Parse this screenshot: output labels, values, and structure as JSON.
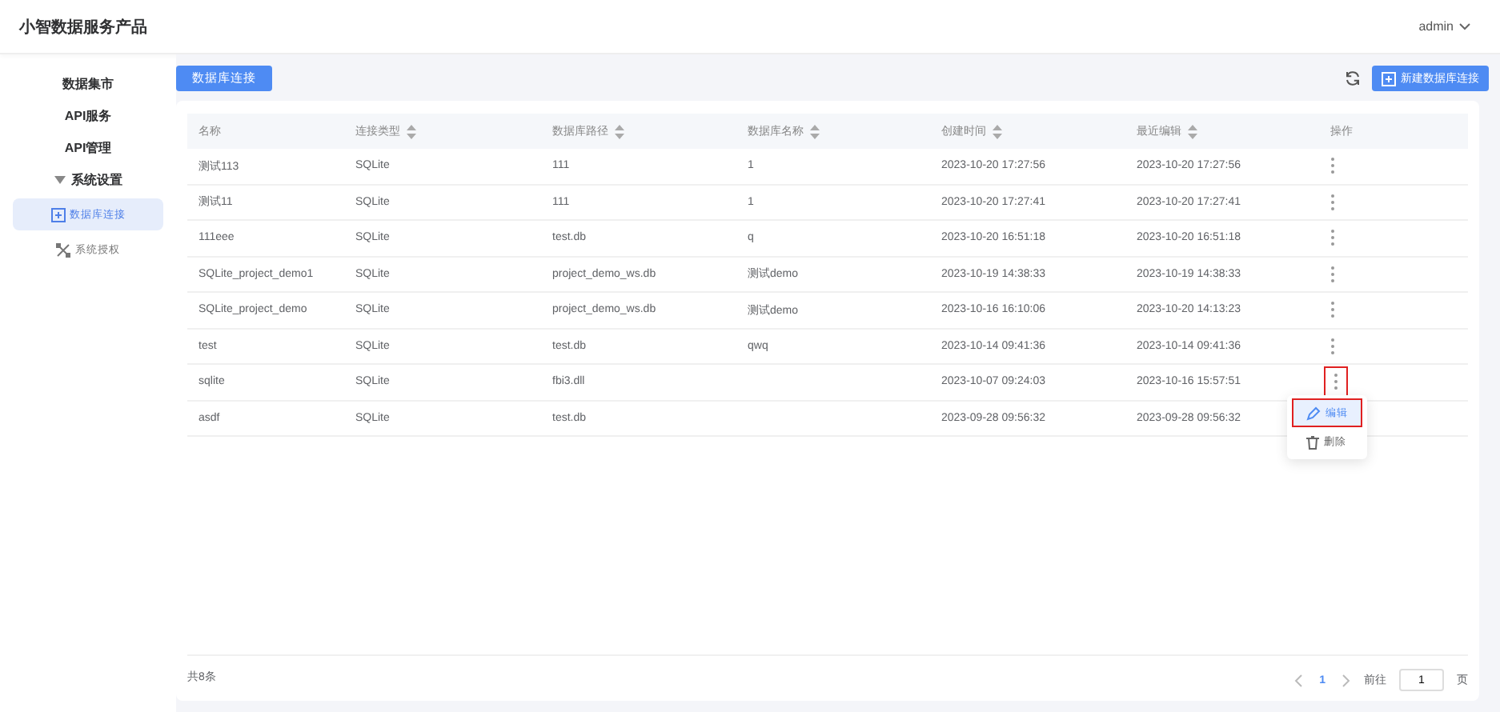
{
  "header": {
    "title": "小智数据服务产品",
    "user": "admin"
  },
  "sidebar": {
    "items": [
      {
        "label": "数据集市",
        "selected": false
      },
      {
        "label": "API服务",
        "selected": false
      },
      {
        "label": "API管理",
        "selected": false
      },
      {
        "label": "系统设置",
        "selected": false,
        "expanded": true,
        "children": [
          {
            "label": "数据库连接",
            "selected": true
          },
          {
            "label": "系统授权",
            "selected": false
          }
        ]
      }
    ]
  },
  "page_tab": "数据库连接",
  "new_button": "新建数据库连接",
  "table": {
    "columns": [
      {
        "label": "名称",
        "sortable": false
      },
      {
        "label": "连接类型",
        "sortable": true
      },
      {
        "label": "数据库路径",
        "sortable": true
      },
      {
        "label": "数据库名称",
        "sortable": true
      },
      {
        "label": "创建时间",
        "sortable": true
      },
      {
        "label": "最近编辑",
        "sortable": true
      },
      {
        "label": "操作",
        "sortable": false
      }
    ],
    "rows": [
      {
        "cells": [
          "测试113",
          "SQLite",
          "111",
          "1",
          "2023-10-20 17:27:56",
          "2023-10-20 17:27:56"
        ],
        "highlighted": false
      },
      {
        "cells": [
          "测试11",
          "SQLite",
          "111",
          "1",
          "2023-10-20 17:27:41",
          "2023-10-20 17:27:41"
        ],
        "highlighted": false
      },
      {
        "cells": [
          "111eee",
          "SQLite",
          "test.db",
          "q",
          "2023-10-20 16:51:18",
          "2023-10-20 16:51:18"
        ],
        "highlighted": false
      },
      {
        "cells": [
          "SQLite_project_demo1",
          "SQLite",
          "project_demo_ws.db",
          "测试demo",
          "2023-10-19 14:38:33",
          "2023-10-19 14:38:33"
        ],
        "highlighted": false
      },
      {
        "cells": [
          "SQLite_project_demo",
          "SQLite",
          "project_demo_ws.db",
          "测试demo",
          "2023-10-16 16:10:06",
          "2023-10-20 14:13:23"
        ],
        "highlighted": false
      },
      {
        "cells": [
          "test",
          "SQLite",
          "test.db",
          "qwq",
          "2023-10-14 09:41:36",
          "2023-10-14 09:41:36"
        ],
        "highlighted": false
      },
      {
        "cells": [
          "sqlite",
          "SQLite",
          "fbi3.dll",
          "",
          "2023-10-07 09:24:03",
          "2023-10-16 15:57:51"
        ],
        "highlighted": true
      },
      {
        "cells": [
          "asdf",
          "SQLite",
          "test.db",
          "",
          "2023-09-28 09:56:32",
          "2023-09-28 09:56:32"
        ]
      }
    ]
  },
  "action_menu": {
    "items": [
      {
        "label": "编辑",
        "kind": "edit",
        "highlighted": true
      },
      {
        "label": "删除",
        "kind": "delete",
        "highlighted": false
      }
    ]
  },
  "pagination": {
    "total": "共8条",
    "pages": [
      {
        "label": "1",
        "selected": true
      }
    ],
    "goto_label": "前往",
    "goto_value": "1",
    "page_unit": "页"
  }
}
